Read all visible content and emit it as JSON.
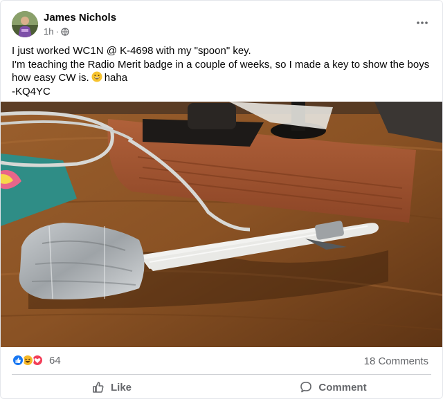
{
  "post": {
    "author": "James Nichols",
    "time": "1h",
    "separator": "·",
    "body_lines": [
      "I just worked WC1N @ K-4698 with my \"spoon\" key.",
      "I'm teaching the Radio Merit badge in a couple of weeks, so I made a key to show the boys how easy CW is.",
      "haha",
      "-KQ4YC"
    ],
    "emoji": "grinning-face-emoji",
    "photo": "photo of homemade spoon morse key on wooden desk"
  },
  "stats": {
    "reaction_count": "64",
    "reaction_types": [
      "like",
      "haha",
      "love"
    ],
    "comments": "18 Comments"
  },
  "actions": {
    "like": "Like",
    "comment": "Comment"
  },
  "colors": {
    "like_blue": "#1877f2",
    "haha_yellow": "#f7b928",
    "love_red": "#f33e58",
    "muted_text": "#65676b"
  }
}
